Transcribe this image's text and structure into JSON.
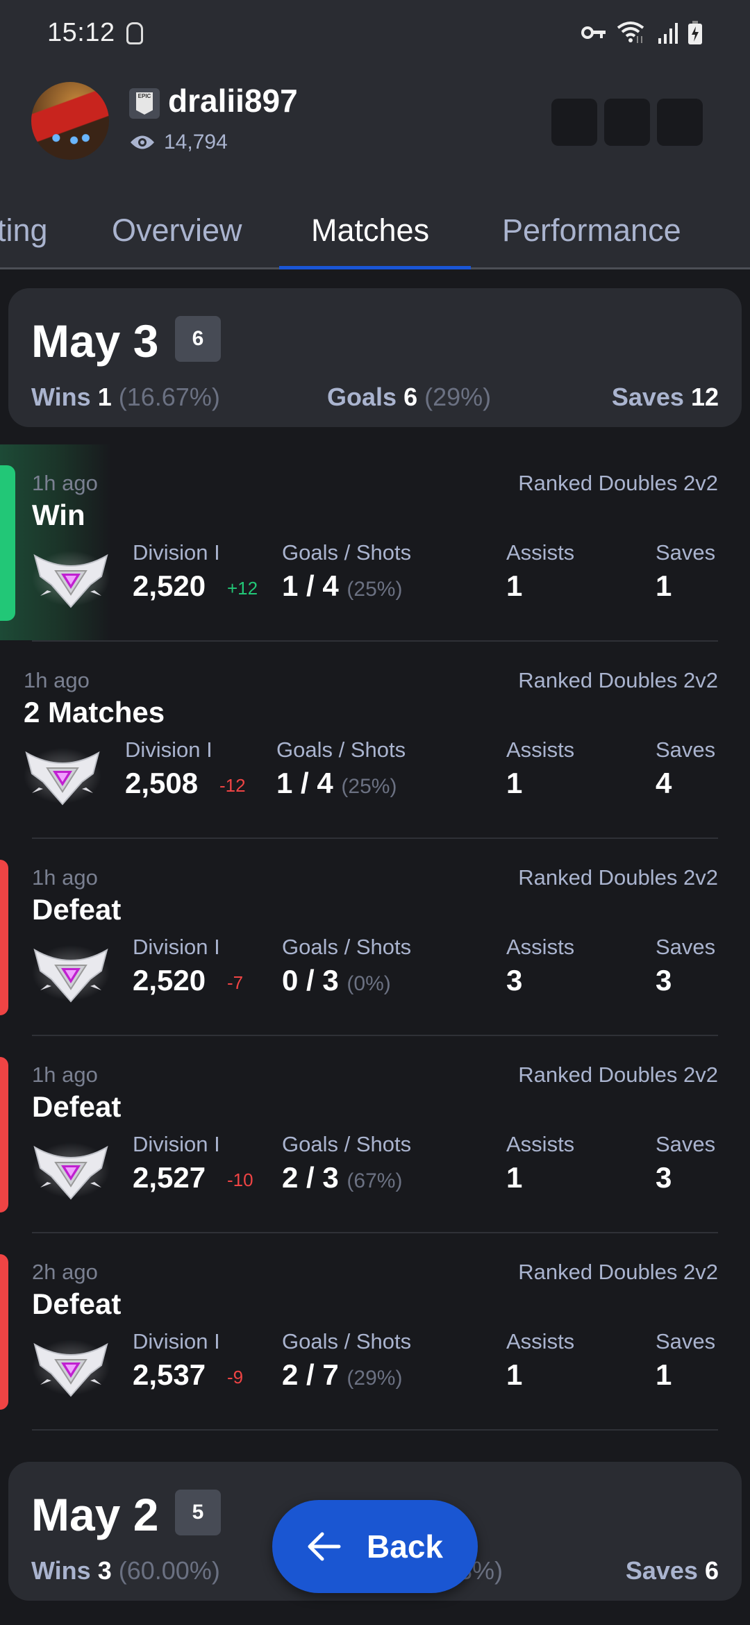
{
  "status_bar": {
    "time": "15:12",
    "left_icons": [
      "dnd-icon"
    ],
    "right_icons": [
      "vpn-key-icon",
      "wifi-icon",
      "signal-icon",
      "battery-charging-icon"
    ]
  },
  "profile": {
    "platform": "EPIC",
    "platform_sub": "GAMES",
    "username": "dralii897",
    "views": "14,794"
  },
  "tabs": [
    {
      "label": "Rating",
      "visible_label": "ting",
      "active": false
    },
    {
      "label": "Overview",
      "active": false
    },
    {
      "label": "Matches",
      "active": true
    },
    {
      "label": "Performance",
      "active": false
    }
  ],
  "days": [
    {
      "title": "May 3",
      "count": "6",
      "wins_label": "Wins",
      "wins_value": "1",
      "wins_pct": "(16.67%)",
      "goals_label": "Goals",
      "goals_value": "6",
      "goals_pct": "(29%)",
      "saves_label": "Saves",
      "saves_value": "12"
    },
    {
      "title": "May 2",
      "count": "5",
      "wins_label": "Wins",
      "wins_value": "3",
      "wins_pct": "(60.00%)",
      "goals_pct_partial": "3%)",
      "saves_label": "Saves",
      "saves_value": "6"
    }
  ],
  "labels": {
    "division": "Division I",
    "goals_shots": "Goals / Shots",
    "assists": "Assists",
    "saves": "Saves"
  },
  "matches": [
    {
      "ago": "1h ago",
      "mode": "Ranked Doubles 2v2",
      "result": "Win",
      "outcome": "win",
      "rating": "2,520",
      "delta": "+12",
      "goals_shots": "1 / 4",
      "pct": "(25%)",
      "assists": "1",
      "saves": "1"
    },
    {
      "ago": "1h ago",
      "mode": "Ranked Doubles 2v2",
      "result": "2 Matches",
      "outcome": "group",
      "rating": "2,508",
      "delta": "-12",
      "goals_shots": "1 / 4",
      "pct": "(25%)",
      "assists": "1",
      "saves": "4"
    },
    {
      "ago": "1h ago",
      "mode": "Ranked Doubles 2v2",
      "result": "Defeat",
      "outcome": "loss",
      "rating": "2,520",
      "delta": "-7",
      "goals_shots": "0 / 3",
      "pct": "(0%)",
      "assists": "3",
      "saves": "3"
    },
    {
      "ago": "1h ago",
      "mode": "Ranked Doubles 2v2",
      "result": "Defeat",
      "outcome": "loss",
      "rating": "2,527",
      "delta": "-10",
      "goals_shots": "2 / 3",
      "pct": "(67%)",
      "assists": "1",
      "saves": "3"
    },
    {
      "ago": "2h ago",
      "mode": "Ranked Doubles 2v2",
      "result": "Defeat",
      "outcome": "loss",
      "rating": "2,537",
      "delta": "-9",
      "goals_shots": "2 / 7",
      "pct": "(29%)",
      "assists": "1",
      "saves": "1"
    }
  ],
  "back_button": {
    "label": "Back",
    "icon": "arrow-left-icon"
  },
  "colors": {
    "accent": "#1a56d6",
    "win": "#22c777",
    "loss": "#ef4444",
    "header_bg": "#2a2c32",
    "page_bg": "#18191d"
  }
}
